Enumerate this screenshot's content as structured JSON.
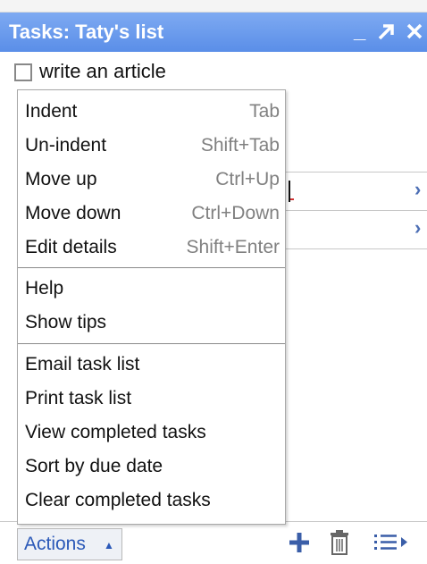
{
  "window": {
    "title": "Tasks: Taty's list",
    "minimize_icon": "minimize-icon",
    "popout_icon": "popout-arrow-icon",
    "close_icon": "close-icon"
  },
  "task": {
    "text": "write an article",
    "checked": false
  },
  "menu": {
    "group1": [
      {
        "label": "Indent",
        "shortcut": "Tab"
      },
      {
        "label": "Un-indent",
        "shortcut": "Shift+Tab"
      },
      {
        "label": "Move up",
        "shortcut": "Ctrl+Up"
      },
      {
        "label": "Move down",
        "shortcut": "Ctrl+Down"
      },
      {
        "label": "Edit details",
        "shortcut": "Shift+Enter"
      }
    ],
    "group2": [
      {
        "label": "Help"
      },
      {
        "label": "Show tips"
      }
    ],
    "group3": [
      {
        "label": "Email task list"
      },
      {
        "label": "Print task list"
      },
      {
        "label": "View completed tasks"
      },
      {
        "label": "Sort by due date"
      },
      {
        "label": "Clear completed tasks"
      }
    ]
  },
  "footer": {
    "actions_label": "Actions",
    "caret_icon": "caret-up-icon",
    "add_icon": "plus-icon",
    "delete_icon": "trash-icon",
    "lists_icon": "list-menu-icon"
  },
  "colors": {
    "titlebar": "#5a8ee8",
    "link": "#2b59b8",
    "shortcut": "#808080"
  }
}
